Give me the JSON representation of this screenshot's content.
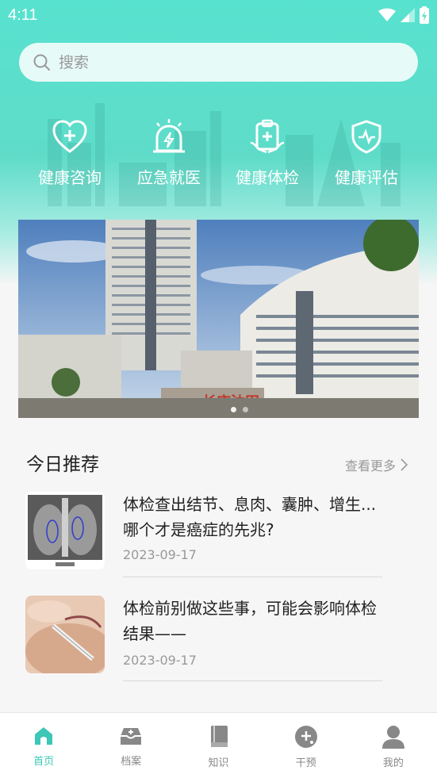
{
  "status_bar": {
    "time": "4:11"
  },
  "search": {
    "placeholder": "搜索"
  },
  "quick_actions": [
    {
      "label": "健康咨询",
      "icon": "heart-plus-icon"
    },
    {
      "label": "应急就医",
      "icon": "emergency-siren-icon"
    },
    {
      "label": "健康体检",
      "icon": "clipboard-health-icon"
    },
    {
      "label": "健康评估",
      "icon": "shield-pulse-icon"
    }
  ],
  "banner": {
    "sign_text": "长庆油田",
    "slides": 2,
    "active_slide": 1
  },
  "recommend": {
    "title": "今日推荐",
    "more_label": "查看更多",
    "articles": [
      {
        "title": "体检查出结节、息肉、囊肿、增生...哪个才是癌症的先兆?",
        "date": "2023-09-17",
        "thumb": "chest-xray-image"
      },
      {
        "title": "体检前别做这些事，可能会影响体检结果——",
        "date": "2023-09-17",
        "thumb": "blood-test-image"
      }
    ]
  },
  "tabbar": {
    "active": "首页",
    "tabs": [
      {
        "label": "首页",
        "icon": "home-icon"
      },
      {
        "label": "档案",
        "icon": "archive-box-icon"
      },
      {
        "label": "知识",
        "icon": "book-icon"
      },
      {
        "label": "干预",
        "icon": "intervention-plus-icon"
      },
      {
        "label": "我的",
        "icon": "user-icon"
      }
    ]
  },
  "colors": {
    "accent": "#3cc7b6",
    "hero_top": "#57e2cf",
    "inactive_tab": "#888888"
  }
}
